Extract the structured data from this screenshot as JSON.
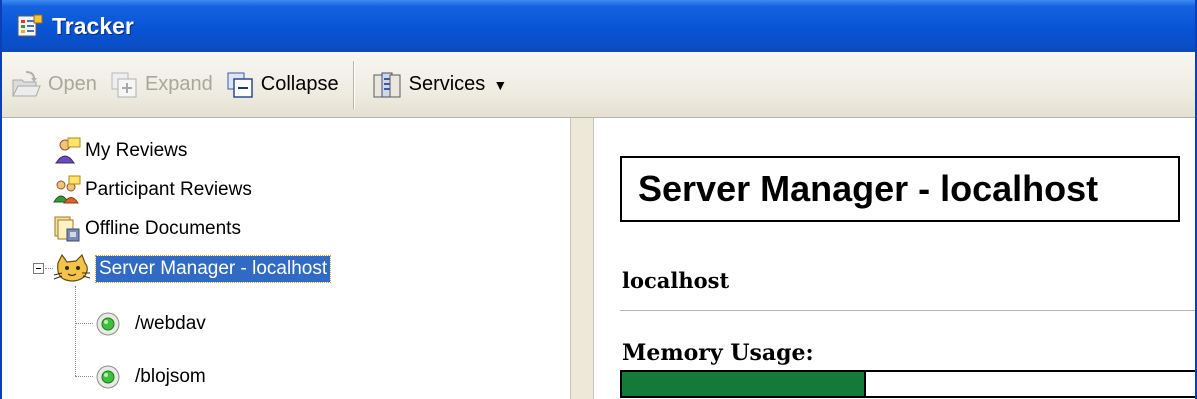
{
  "window": {
    "title": "Tracker"
  },
  "toolbar": {
    "open_label": "Open",
    "expand_label": "Expand",
    "collapse_label": "Collapse",
    "services_label": "Services"
  },
  "tree": {
    "items": [
      {
        "label": "My Reviews",
        "icon": "reviews-icon"
      },
      {
        "label": "Participant Reviews",
        "icon": "participants-icon"
      },
      {
        "label": "Offline Documents",
        "icon": "offline-docs-icon"
      },
      {
        "label": "Server Manager - localhost",
        "icon": "tomcat-icon",
        "selected": true,
        "expanded": true
      },
      {
        "label": "/webdav",
        "icon": "status-ok-icon"
      },
      {
        "label": "/blojsom",
        "icon": "status-ok-icon"
      }
    ]
  },
  "content": {
    "title": "Server Manager - localhost",
    "host": "localhost",
    "memory_label": "Memory Usage:",
    "memory_usage_fraction": 0.41
  },
  "colors": {
    "titlebar": "#0754d6",
    "selection": "#316ac5",
    "memory_bar": "#147a3a"
  }
}
